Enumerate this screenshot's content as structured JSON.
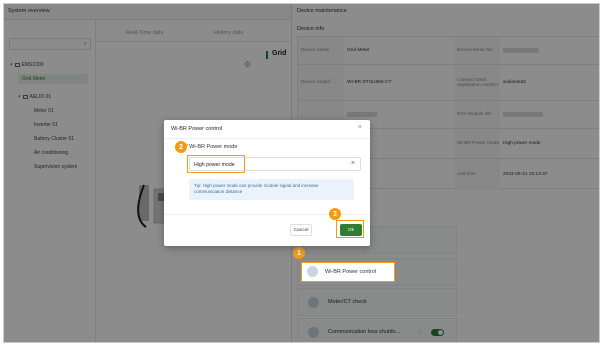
{
  "header": {
    "title": "System overview"
  },
  "tree": {
    "search_placeholder": "",
    "nodes": [
      {
        "label": "EMS1000",
        "level": 0
      },
      {
        "label": "Grid Meter",
        "level": 1,
        "selected": true
      },
      {
        "label": "AELIO 01",
        "level": 1
      },
      {
        "label": "Meter 01",
        "level": 2
      },
      {
        "label": "Inverter 01",
        "level": 2
      },
      {
        "label": "Battery Cluster 01",
        "level": 2
      },
      {
        "label": "Air conditioning",
        "level": 2
      },
      {
        "label": "Supervision system",
        "level": 2
      }
    ]
  },
  "middle": {
    "tabs": [
      "Real-Time data",
      "History data"
    ],
    "section_title": "Grid"
  },
  "drawer": {
    "title": "Device maintenance",
    "subtitle": "Device info",
    "rows": [
      {
        "l1": "Device name",
        "v1": "Grid Meter",
        "l2": "Device serial No.",
        "v2": ""
      },
      {
        "l1": "Device model",
        "v1": "WI-BR DTSU666-CT",
        "l2": "Connect EMS registration number",
        "v2": "wulianted2"
      },
      {
        "l1": "",
        "v1": "",
        "l2": "DTA-Module SN",
        "v2": ""
      },
      {
        "l1": "",
        "v1": "",
        "l2": "Wi-BR Power mode",
        "v2": "High power mode"
      },
      {
        "l1": "",
        "v1": "eter",
        "l2": "Add time",
        "v2": "2024-09-21 22:14:47"
      }
    ],
    "cards": [
      {
        "label": "Wi-BR Power control"
      },
      {
        "label": "Meter/CT check"
      },
      {
        "label": "Communication loss shutdo..."
      }
    ]
  },
  "modal": {
    "title": "Wi-BR Power control",
    "close": "×",
    "field_label": "Wi-BR Power mode",
    "required_mark": "*",
    "field_value": "High power mode",
    "clear": "×",
    "tip": "Tip: High power mode can provide module signal and increase communication distance",
    "cancel": "Cancel",
    "ok": "Ok"
  },
  "steps": [
    "1",
    "2",
    "3"
  ],
  "colors": {
    "accent": "#2e7d32",
    "highlight": "#f39c12",
    "tip_bg": "#eaf3fb"
  }
}
